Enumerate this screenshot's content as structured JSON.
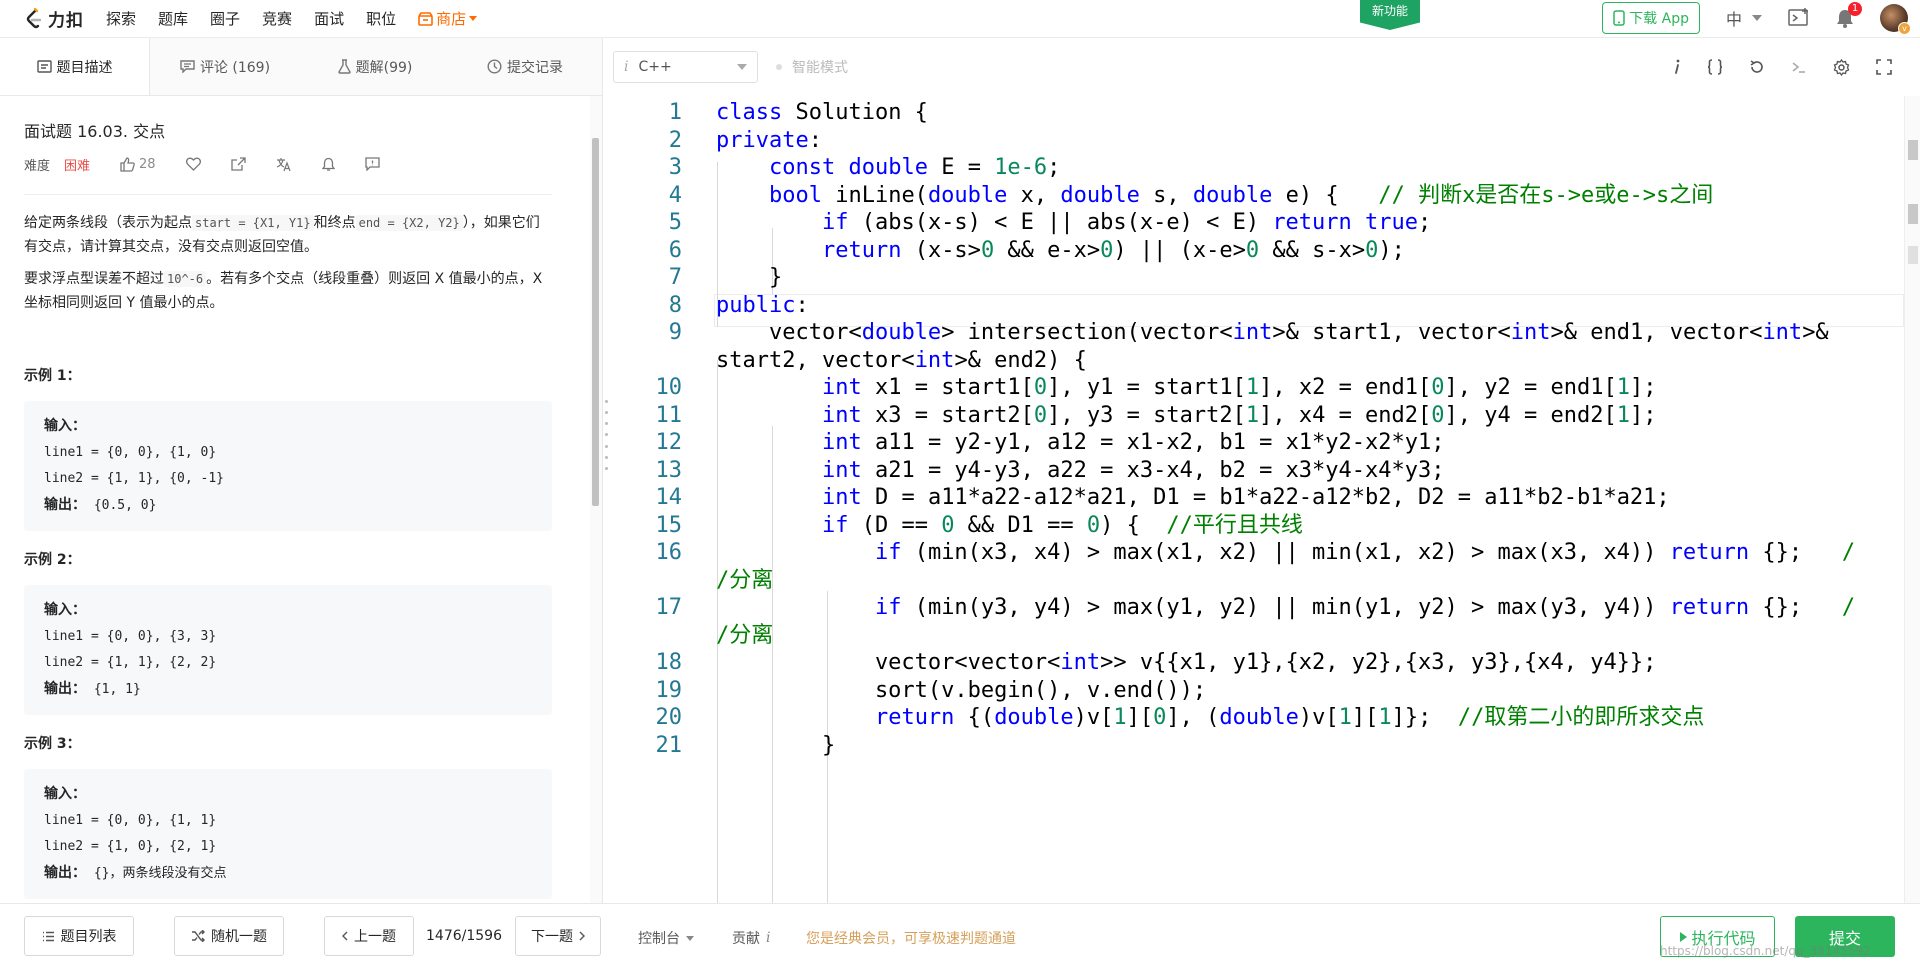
{
  "nav": {
    "logo_text": "力扣",
    "links": [
      "探索",
      "题库",
      "圈子",
      "竞赛",
      "面试",
      "职位"
    ],
    "store": "商店",
    "new_feature": "新功能",
    "download_app": "下载 App",
    "lang": "中",
    "notif_count": "1"
  },
  "tabs": [
    {
      "label": "题目描述",
      "icon": "description-icon"
    },
    {
      "label": "评论 (169)",
      "icon": "comment-icon"
    },
    {
      "label": "题解(99)",
      "icon": "flask-icon"
    },
    {
      "label": "提交记录",
      "icon": "clock-icon"
    }
  ],
  "problem": {
    "title": "面试题 16.03. 交点",
    "difficulty_label": "难度",
    "difficulty": "困难",
    "likes": "28",
    "desc1_a": "给定两条线段（表示为起点",
    "desc1_code1": "start = {X1, Y1}",
    "desc1_b": "和终点",
    "desc1_code2": "end = {X2, Y2}",
    "desc1_c": "），如果它们有交点，请计算其交点，没有交点则返回空值。",
    "desc2_a": "要求浮点型误差不超过",
    "desc2_code": "10^-6",
    "desc2_b": "。若有多个交点（线段重叠）则返回 X 值最小的点，X 坐标相同则返回 Y 值最小的点。",
    "examples": [
      {
        "title": "示例 1：",
        "input_label": "输入：",
        "line1": "line1 = {0, 0}, {1, 0}",
        "line2": "line2 = {1, 1}, {0, -1}",
        "output_label": "输出：",
        "output": "{0.5, 0}"
      },
      {
        "title": "示例 2：",
        "input_label": "输入：",
        "line1": "line1 = {0, 0}, {3, 3}",
        "line2": "line2 = {1, 1}, {2, 2}",
        "output_label": "输出：",
        "output": "{1, 1}"
      },
      {
        "title": "示例 3：",
        "input_label": "输入：",
        "line1": "line1 = {0, 0}, {1, 1}",
        "line2": "line2 = {1, 0}, {2, 1}",
        "output_label": "输出：",
        "output": "{}，两条线段没有交点"
      }
    ]
  },
  "editor": {
    "language_prefix": "i",
    "language": "C++",
    "smart_mode": "智能模式",
    "lines": [
      {
        "n": "1",
        "html": "<span class=\"kw\">class</span> Solution {"
      },
      {
        "n": "2",
        "html": "<span class=\"kw\">private</span>:"
      },
      {
        "n": "3",
        "html": "    <span class=\"kw\">const</span> <span class=\"kw\">double</span> E = <span class=\"num\">1e-6</span>;"
      },
      {
        "n": "4",
        "html": "    <span class=\"kw\">bool</span> inLine(<span class=\"kw\">double</span> x, <span class=\"kw\">double</span> s, <span class=\"kw\">double</span> e) {   <span class=\"cm\">// 判断x是否在s-&gt;e或e-&gt;s之间</span>"
      },
      {
        "n": "5",
        "html": "        <span class=\"kw\">if</span> (abs(x-s) &lt; E || abs(x-e) &lt; E) <span class=\"kw\">return</span> <span class=\"kw\">true</span>;"
      },
      {
        "n": "6",
        "html": "        <span class=\"kw\">return</span> (x-s&gt;<span class=\"num\">0</span> &amp;&amp; e-x&gt;<span class=\"num\">0</span>) || (x-e&gt;<span class=\"num\">0</span> &amp;&amp; s-x&gt;<span class=\"num\">0</span>);"
      },
      {
        "n": "7",
        "html": "    }"
      },
      {
        "n": "8",
        "html": "<span class=\"kw\">public</span>:"
      },
      {
        "n": "9",
        "html": "    vector&lt;<span class=\"kw\">double</span>&gt; intersection(vector&lt;<span class=\"kw\">int</span>&gt;&amp; start1, vector&lt;<span class=\"kw\">int</span>&gt;&amp; end1, vector&lt;<span class=\"kw\">int</span>&gt;&amp;"
      },
      {
        "n": "",
        "html": "start2, vector&lt;<span class=\"kw\">int</span>&gt;&amp; end2) {"
      },
      {
        "n": "10",
        "html": "        <span class=\"kw\">int</span> x1 = start1[<span class=\"num\">0</span>], y1 = start1[<span class=\"num\">1</span>], x2 = end1[<span class=\"num\">0</span>], y2 = end1[<span class=\"num\">1</span>];"
      },
      {
        "n": "11",
        "html": "        <span class=\"kw\">int</span> x3 = start2[<span class=\"num\">0</span>], y3 = start2[<span class=\"num\">1</span>], x4 = end2[<span class=\"num\">0</span>], y4 = end2[<span class=\"num\">1</span>];"
      },
      {
        "n": "12",
        "html": "        <span class=\"kw\">int</span> a11 = y2-y1, a12 = x1-x2, b1 = x1*y2-x2*y1;"
      },
      {
        "n": "13",
        "html": "        <span class=\"kw\">int</span> a21 = y4-y3, a22 = x3-x4, b2 = x3*y4-x4*y3;"
      },
      {
        "n": "14",
        "html": "        <span class=\"kw\">int</span> D = a11*a22-a12*a21, D1 = b1*a22-a12*b2, D2 = a11*b2-b1*a21;"
      },
      {
        "n": "15",
        "html": "        <span class=\"kw\">if</span> (D == <span class=\"num\">0</span> &amp;&amp; D1 == <span class=\"num\">0</span>) {  <span class=\"cm\">//平行且共线</span>"
      },
      {
        "n": "16",
        "html": "            <span class=\"kw\">if</span> (min(x3, x4) &gt; max(x1, x2) || min(x1, x2) &gt; max(x3, x4)) <span class=\"kw\">return</span> {};   <span class=\"cm\">/</span>"
      },
      {
        "n": "",
        "html": "<span class=\"cm\">/分离</span>"
      },
      {
        "n": "17",
        "html": "            <span class=\"kw\">if</span> (min(y3, y4) &gt; max(y1, y2) || min(y1, y2) &gt; max(y3, y4)) <span class=\"kw\">return</span> {};   <span class=\"cm\">/</span>"
      },
      {
        "n": "",
        "html": "<span class=\"cm\">/分离</span>"
      },
      {
        "n": "18",
        "html": "            vector&lt;vector&lt;<span class=\"kw\">int</span>&gt;&gt; v{{x1, y1},{x2, y2},{x3, y3},{x4, y4}};"
      },
      {
        "n": "19",
        "html": "            sort(v.begin(), v.end());"
      },
      {
        "n": "20",
        "html": "            <span class=\"kw\">return</span> {(<span class=\"kw\">double</span>)v[<span class=\"num\">1</span>][<span class=\"num\">0</span>], (<span class=\"kw\">double</span>)v[<span class=\"num\">1</span>][<span class=\"num\">1</span>]};  <span class=\"cm\">//取第二小的即所求交点</span>"
      },
      {
        "n": "21",
        "html": "        }"
      }
    ]
  },
  "bottom": {
    "problem_list": "题目列表",
    "random": "随机一题",
    "prev": "上一题",
    "page": "1476/1596",
    "next": "下一题",
    "console": "控制台",
    "contribute": "贡献",
    "contribute_i": "i",
    "vip_msg": "您是经典会员，可享极速判题通道",
    "run": "执行代码",
    "submit": "提交",
    "watermark": "https://blog.csdn.net/qq_38145592"
  },
  "colors": {
    "accent": "#2db55d",
    "hard": "#ec4c47",
    "store": "#ff6b00",
    "keyword": "#0000ff",
    "number": "#09885a",
    "comment": "#008000"
  }
}
